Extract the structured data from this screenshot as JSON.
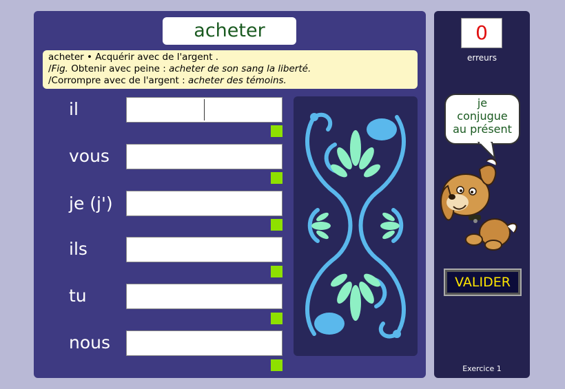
{
  "verb": "acheter",
  "definition": {
    "line1_word": "acheter",
    "line1_bullet": "•",
    "line1_text": "Acquérir avec de l'argent .",
    "line2_prefix": "/",
    "line2_fig": "Fig.",
    "line2_text": " Obtenir avec peine : ",
    "line2_example": "acheter de son sang la liberté.",
    "line3_text": "/Corrompre avec de l'argent : ",
    "line3_example": "acheter des témoins."
  },
  "rows": [
    {
      "pronoun": "il",
      "value": ""
    },
    {
      "pronoun": "vous",
      "value": ""
    },
    {
      "pronoun": "je (j')",
      "value": ""
    },
    {
      "pronoun": "ils",
      "value": ""
    },
    {
      "pronoun": "tu",
      "value": ""
    },
    {
      "pronoun": "nous",
      "value": ""
    }
  ],
  "errors": {
    "count": "0",
    "label": "erreurs"
  },
  "speech": {
    "line1": "je",
    "line2": "conjugue",
    "line3": "au présent"
  },
  "validate_label": "VALIDER",
  "exercise_label": "Exercice 1",
  "colors": {
    "background": "#b9b9d6",
    "main_panel": "#3e3a82",
    "side_panel": "#24224f",
    "title_text": "#1a5a20",
    "definition_bg": "#fdf7c6",
    "check": "#8ee000",
    "error_text": "#e01010",
    "validate_text": "#ffe600",
    "ornament_blue": "#5ab8ec",
    "ornament_mint": "#8ef0c4"
  },
  "icons": {
    "ornament": "decorative-ornament",
    "mascot": "puppy-mascot"
  }
}
